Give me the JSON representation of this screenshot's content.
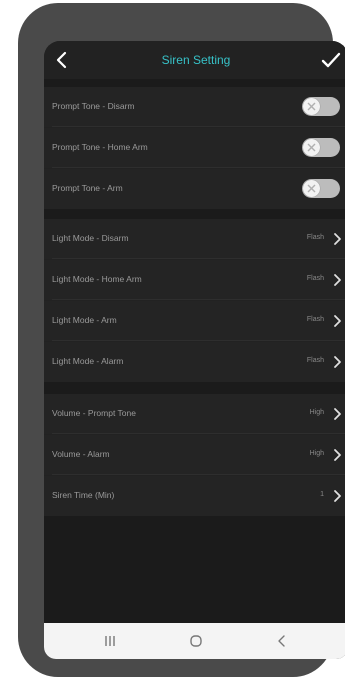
{
  "header": {
    "title": "Siren Setting"
  },
  "colors": {
    "title": "#37c2c8",
    "background": "#222222",
    "row_label": "#9a9a9a",
    "toggle_off": "#bcbcbc"
  },
  "sections": {
    "prompt_tone": [
      {
        "label": "Prompt Tone - Disarm",
        "enabled": false
      },
      {
        "label": "Prompt Tone - Home Arm",
        "enabled": false
      },
      {
        "label": "Prompt Tone - Arm",
        "enabled": false
      }
    ],
    "light_mode": [
      {
        "label": "Light Mode - Disarm",
        "value": "Flash"
      },
      {
        "label": "Light Mode - Home Arm",
        "value": "Flash"
      },
      {
        "label": "Light Mode - Arm",
        "value": "Flash"
      },
      {
        "label": "Light Mode - Alarm",
        "value": "Flash"
      }
    ],
    "volume": [
      {
        "label": "Volume - Prompt Tone",
        "value": "High"
      },
      {
        "label": "Volume - Alarm",
        "value": "High"
      },
      {
        "label": "Siren Time (Min)",
        "value": "1"
      }
    ]
  },
  "icons": {
    "back": "chevron-left-icon",
    "confirm": "checkmark-icon",
    "toggle_knob": "x-icon",
    "row_arrow": "chevron-right-icon",
    "nav_recent": "recent-apps-icon",
    "nav_home": "home-icon",
    "nav_back": "back-icon"
  }
}
